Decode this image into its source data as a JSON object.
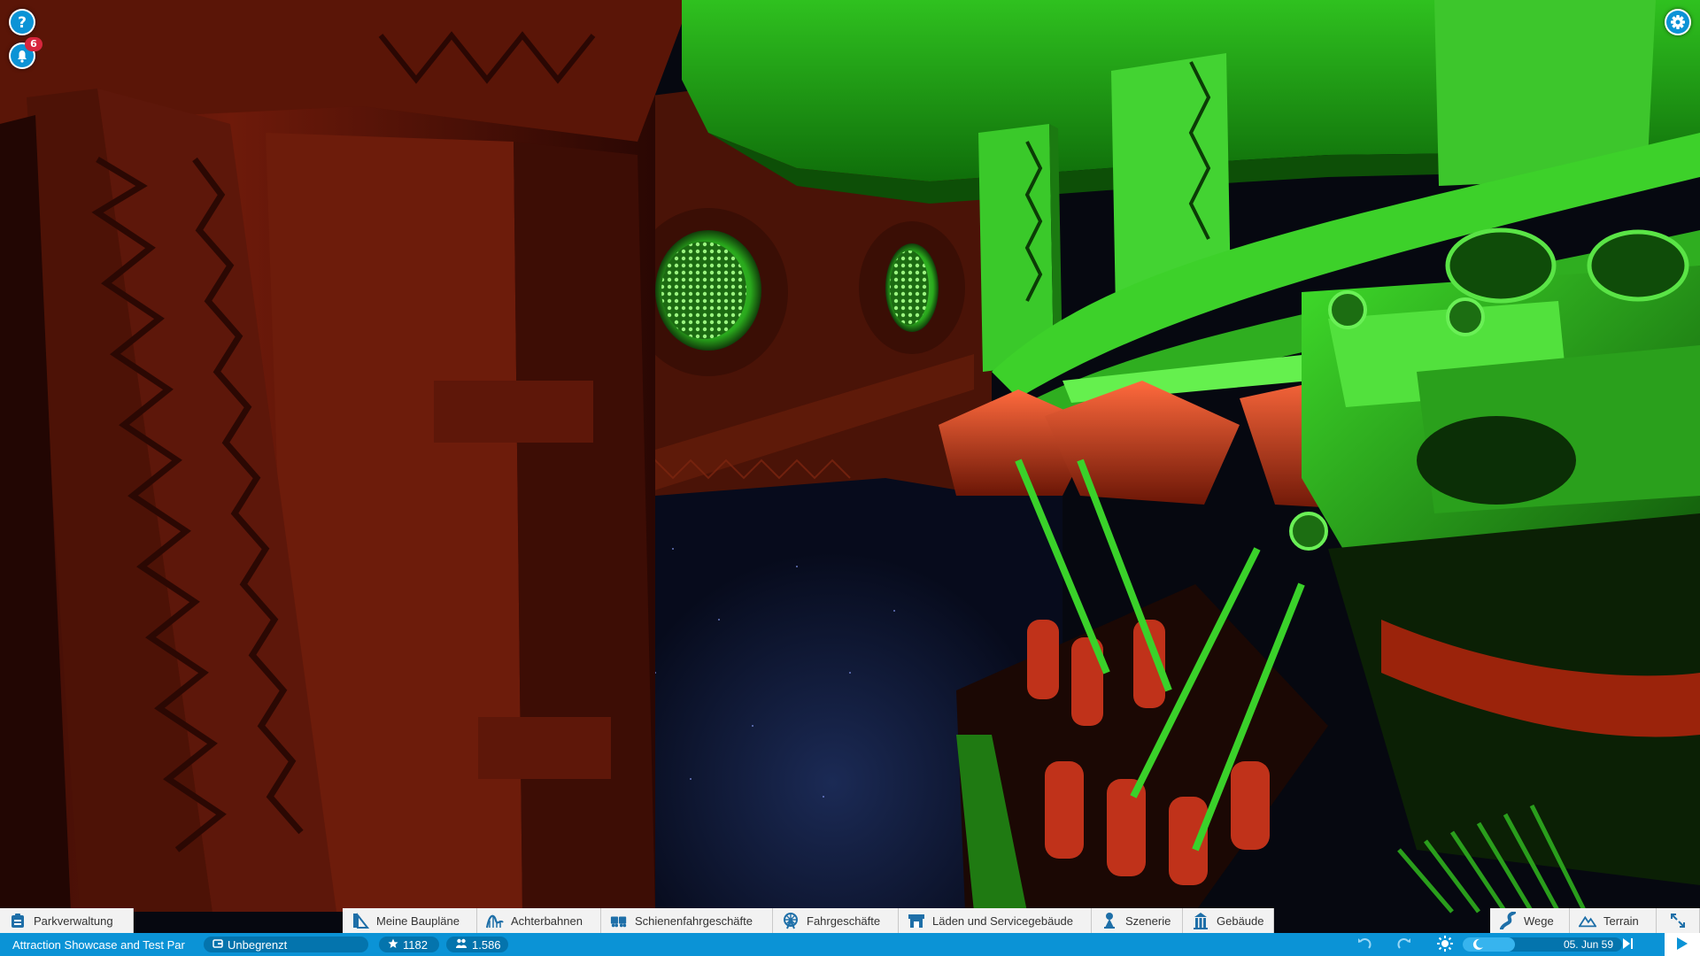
{
  "notifications": {
    "count": "6"
  },
  "toolbar": {
    "park_management": "Parkverwaltung",
    "blueprints": "Meine Baupläne",
    "coasters": "Achterbahnen",
    "track_rides": "Schienenfahrgeschäfte",
    "flat_rides": "Fahrgeschäfte",
    "shops": "Läden und Servicegebäude",
    "scenery": "Szenerie",
    "buildings": "Gebäude",
    "paths": "Wege",
    "terrain": "Terrain"
  },
  "status": {
    "park_name": "Attraction Showcase and Test Par",
    "money": "Unbegrenzt",
    "rating": "1182",
    "guests": "1.586",
    "date": "05. Jun 59",
    "date_progress": 0.33
  },
  "icons": {
    "help": "help-icon",
    "notifications": "bell-icon",
    "settings": "gear-icon",
    "undo": "undo-icon",
    "redo": "redo-icon",
    "weather": "sun-icon",
    "daynight": "moon-icon",
    "play": "play-icon",
    "fast_forward": "fast-forward-icon",
    "collapse": "collapse-icon"
  },
  "colors": {
    "accent": "#0b93d6",
    "toolbar_icon": "#1e6fa8",
    "badge": "#d7263d"
  }
}
